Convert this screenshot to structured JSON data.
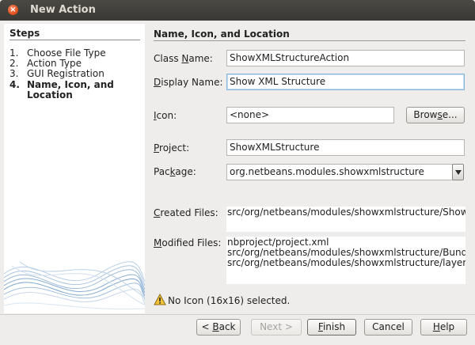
{
  "window": {
    "title": "New Action"
  },
  "steps": {
    "heading": "Steps",
    "items": [
      {
        "num": "1.",
        "label": "Choose File Type"
      },
      {
        "num": "2.",
        "label": "Action Type"
      },
      {
        "num": "3.",
        "label": "GUI Registration"
      },
      {
        "num": "4.",
        "label": "Name, Icon, and Location"
      }
    ]
  },
  "section": {
    "title": "Name, Icon, and Location"
  },
  "form": {
    "class_name": {
      "label_pre": "Class ",
      "label_mn": "N",
      "label_post": "ame:",
      "value": "ShowXMLStructureAction"
    },
    "display_name": {
      "label_pre": "",
      "label_mn": "D",
      "label_post": "isplay Name:",
      "value": "Show XML Structure"
    },
    "icon": {
      "label_pre": "",
      "label_mn": "I",
      "label_post": "con:",
      "value": "<none>"
    },
    "browse_button": {
      "pre": "Brow",
      "mn": "s",
      "post": "e..."
    },
    "project": {
      "label_pre": "",
      "label_mn": "P",
      "label_post": "roject:",
      "value": "ShowXMLStructure"
    },
    "package": {
      "label_pre": "Pac",
      "label_mn": "k",
      "label_post": "age:",
      "value": "org.netbeans.modules.showxmlstructure"
    },
    "created_files": {
      "label_pre": "",
      "label_mn": "C",
      "label_post": "reated Files:",
      "value": "src/org/netbeans/modules/showxmlstructure/ShowXMLStructureAction.java"
    },
    "modified_files": {
      "label_pre": "",
      "label_mn": "M",
      "label_post": "odified Files:",
      "lines": [
        "nbproject/project.xml",
        "src/org/netbeans/modules/showxmlstructure/Bundle.properties",
        "src/org/netbeans/modules/showxmlstructure/layer.xml"
      ]
    }
  },
  "status": {
    "message": "No Icon (16x16) selected.",
    "icon": "warning-icon"
  },
  "buttons": {
    "back": {
      "pre": "< ",
      "mn": "B",
      "post": "ack"
    },
    "next": {
      "pre": "Next >",
      "mn": "",
      "post": ""
    },
    "finish": {
      "pre": "",
      "mn": "F",
      "post": "inish"
    },
    "cancel": {
      "pre": "Cancel",
      "mn": "",
      "post": ""
    },
    "help": {
      "pre": "",
      "mn": "H",
      "post": "elp"
    }
  },
  "colors": {
    "title_bar": "#3c3b37",
    "close_button": "#e65a24",
    "panel_bg": "#eeedeb",
    "focus_border": "#8bb5db"
  }
}
